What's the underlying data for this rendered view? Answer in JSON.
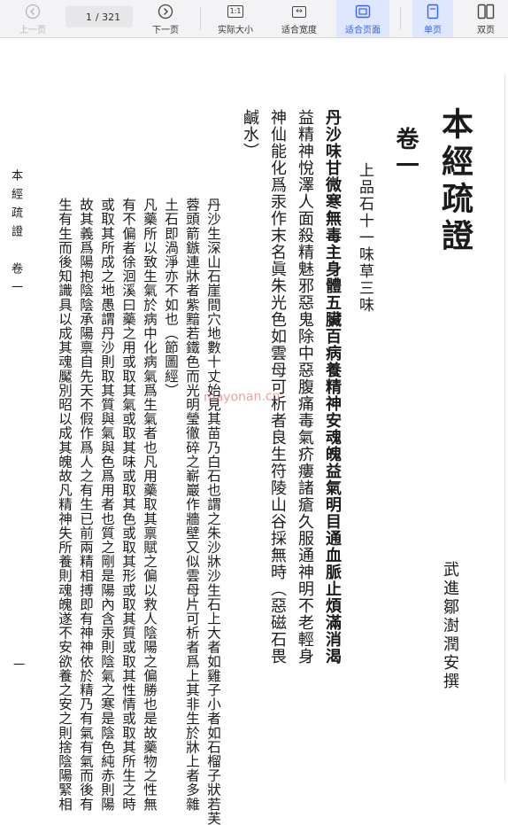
{
  "toolbar": {
    "prev": {
      "label": "上一页",
      "icon": "chevron-up-icon"
    },
    "page": {
      "current": "1",
      "total": "/ 321"
    },
    "next": {
      "label": "下一页",
      "icon": "chevron-down-icon"
    },
    "actual_size": {
      "label": "实际大小",
      "icon": "actual-size-icon",
      "icon_text": "1:1"
    },
    "fit_width": {
      "label": "适合宽度",
      "icon": "fit-width-icon",
      "icon_text": "↔"
    },
    "fit_page": {
      "label": "适合页面",
      "icon": "fit-page-icon"
    },
    "single_page": {
      "label": "单页",
      "icon": "single-page-icon"
    },
    "double_page": {
      "label": "双页",
      "icon": "double-page-icon"
    },
    "active_color": "#2f62ff"
  },
  "document": {
    "title": "本經疏證",
    "volume": "卷一",
    "section": "上品石十一味草三味",
    "author": "武進鄒澍潤安撰",
    "main_text": [
      "丹沙味甘微寒無毒主身體五臟百病養精神安魂魄益氣明目通血脈止煩滿消渴",
      "益精神悅澤人面殺精魅邪惡鬼除中惡腹痛毒氣疥瘻諸瘡久服通神明不老輕身",
      "神仙能化爲汞作末名眞朱光色如雲母可析者良生符陵山谷採無時（惡磁石畏",
      "鹹水）"
    ],
    "commentary": [
      "丹沙生深山石崖間穴地數十丈始見其苗乃白石也謂之朱沙牀沙生石上大者如雞子小者如石榴子狀若芙",
      "蓉頭箭鏃連牀者紫黯若鐵色而光明瑩徹碎之嶄巖作牆壁又似雲母片可析者爲上其非生於牀上者多雜",
      "土石即渦淨亦不如也（節圖經）",
      "凡藥所以致生氣於病中化病氣爲生氣者也凡用藥取其禀賦之偏以救人陰陽之偏勝也是故藥物之性無",
      "有不偏者徐洄溪曰藥之用或取其氣或取其味或取其色或取其形或取其質或取其性情或取其所生之時",
      "或取其所成之地愚謂丹沙則取其質與氣與色爲用者也質之剛是陽內含汞則陰氣之寒是陰色純赤則陽",
      "故其義爲陽抱陰陰承陽禀自先天不假作爲人之有生已前兩精相搏即有神神依於精乃有氣有氣而後有",
      "生有生而後知識具以成其魂魘別昭以成其魄故凡精神失所養則魂魄遂不安欲養之安之則捨陰陽緊相"
    ],
    "margin_title": "本經疏證　卷一",
    "page_number": "一"
  },
  "watermark": {
    "text": "mayonan.cn",
    "color": "#e15050"
  }
}
